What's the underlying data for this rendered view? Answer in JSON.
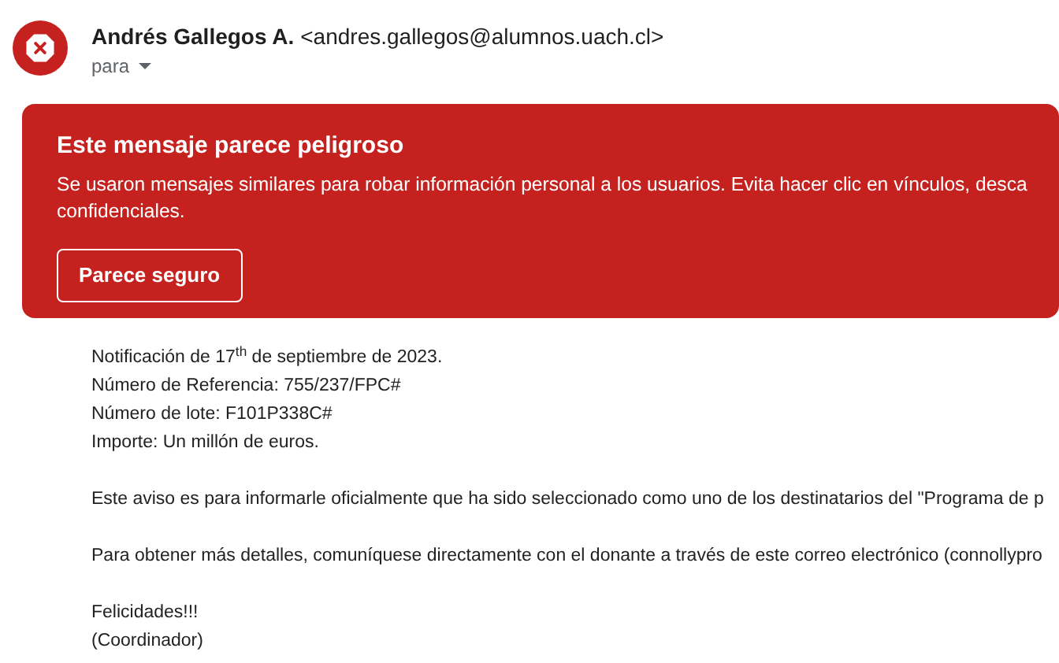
{
  "sender": {
    "name": "Andrés Gallegos A.",
    "address": "<andres.gallegos@alumnos.uach.cl>",
    "recipient_label": "para"
  },
  "warning": {
    "title": "Este mensaje parece peligroso",
    "text": "Se usaron mensajes similares para robar información personal a los usuarios. Evita hacer clic en vínculos, desca",
    "text_line_2": "confidenciales.",
    "button": "Parece seguro"
  },
  "body": [
    [
      "Notificación de 17$^{th}$ de septiembre de 2023.",
      "Número de Referencia: 755/237/FPC#",
      "Número de lote: F101P338C#",
      "Importe: Un millón de euros."
    ],
    [
      "Este aviso es para informarle oficialmente que ha sido seleccionado como uno de los destinatarios del \"Programa de p"
    ],
    [
      "Para obtener más detalles, comuníquese directamente con el donante a través de este correo electrónico (connollypro"
    ],
    [
      "Felicidades!!!",
      "(Coordinador)"
    ]
  ]
}
